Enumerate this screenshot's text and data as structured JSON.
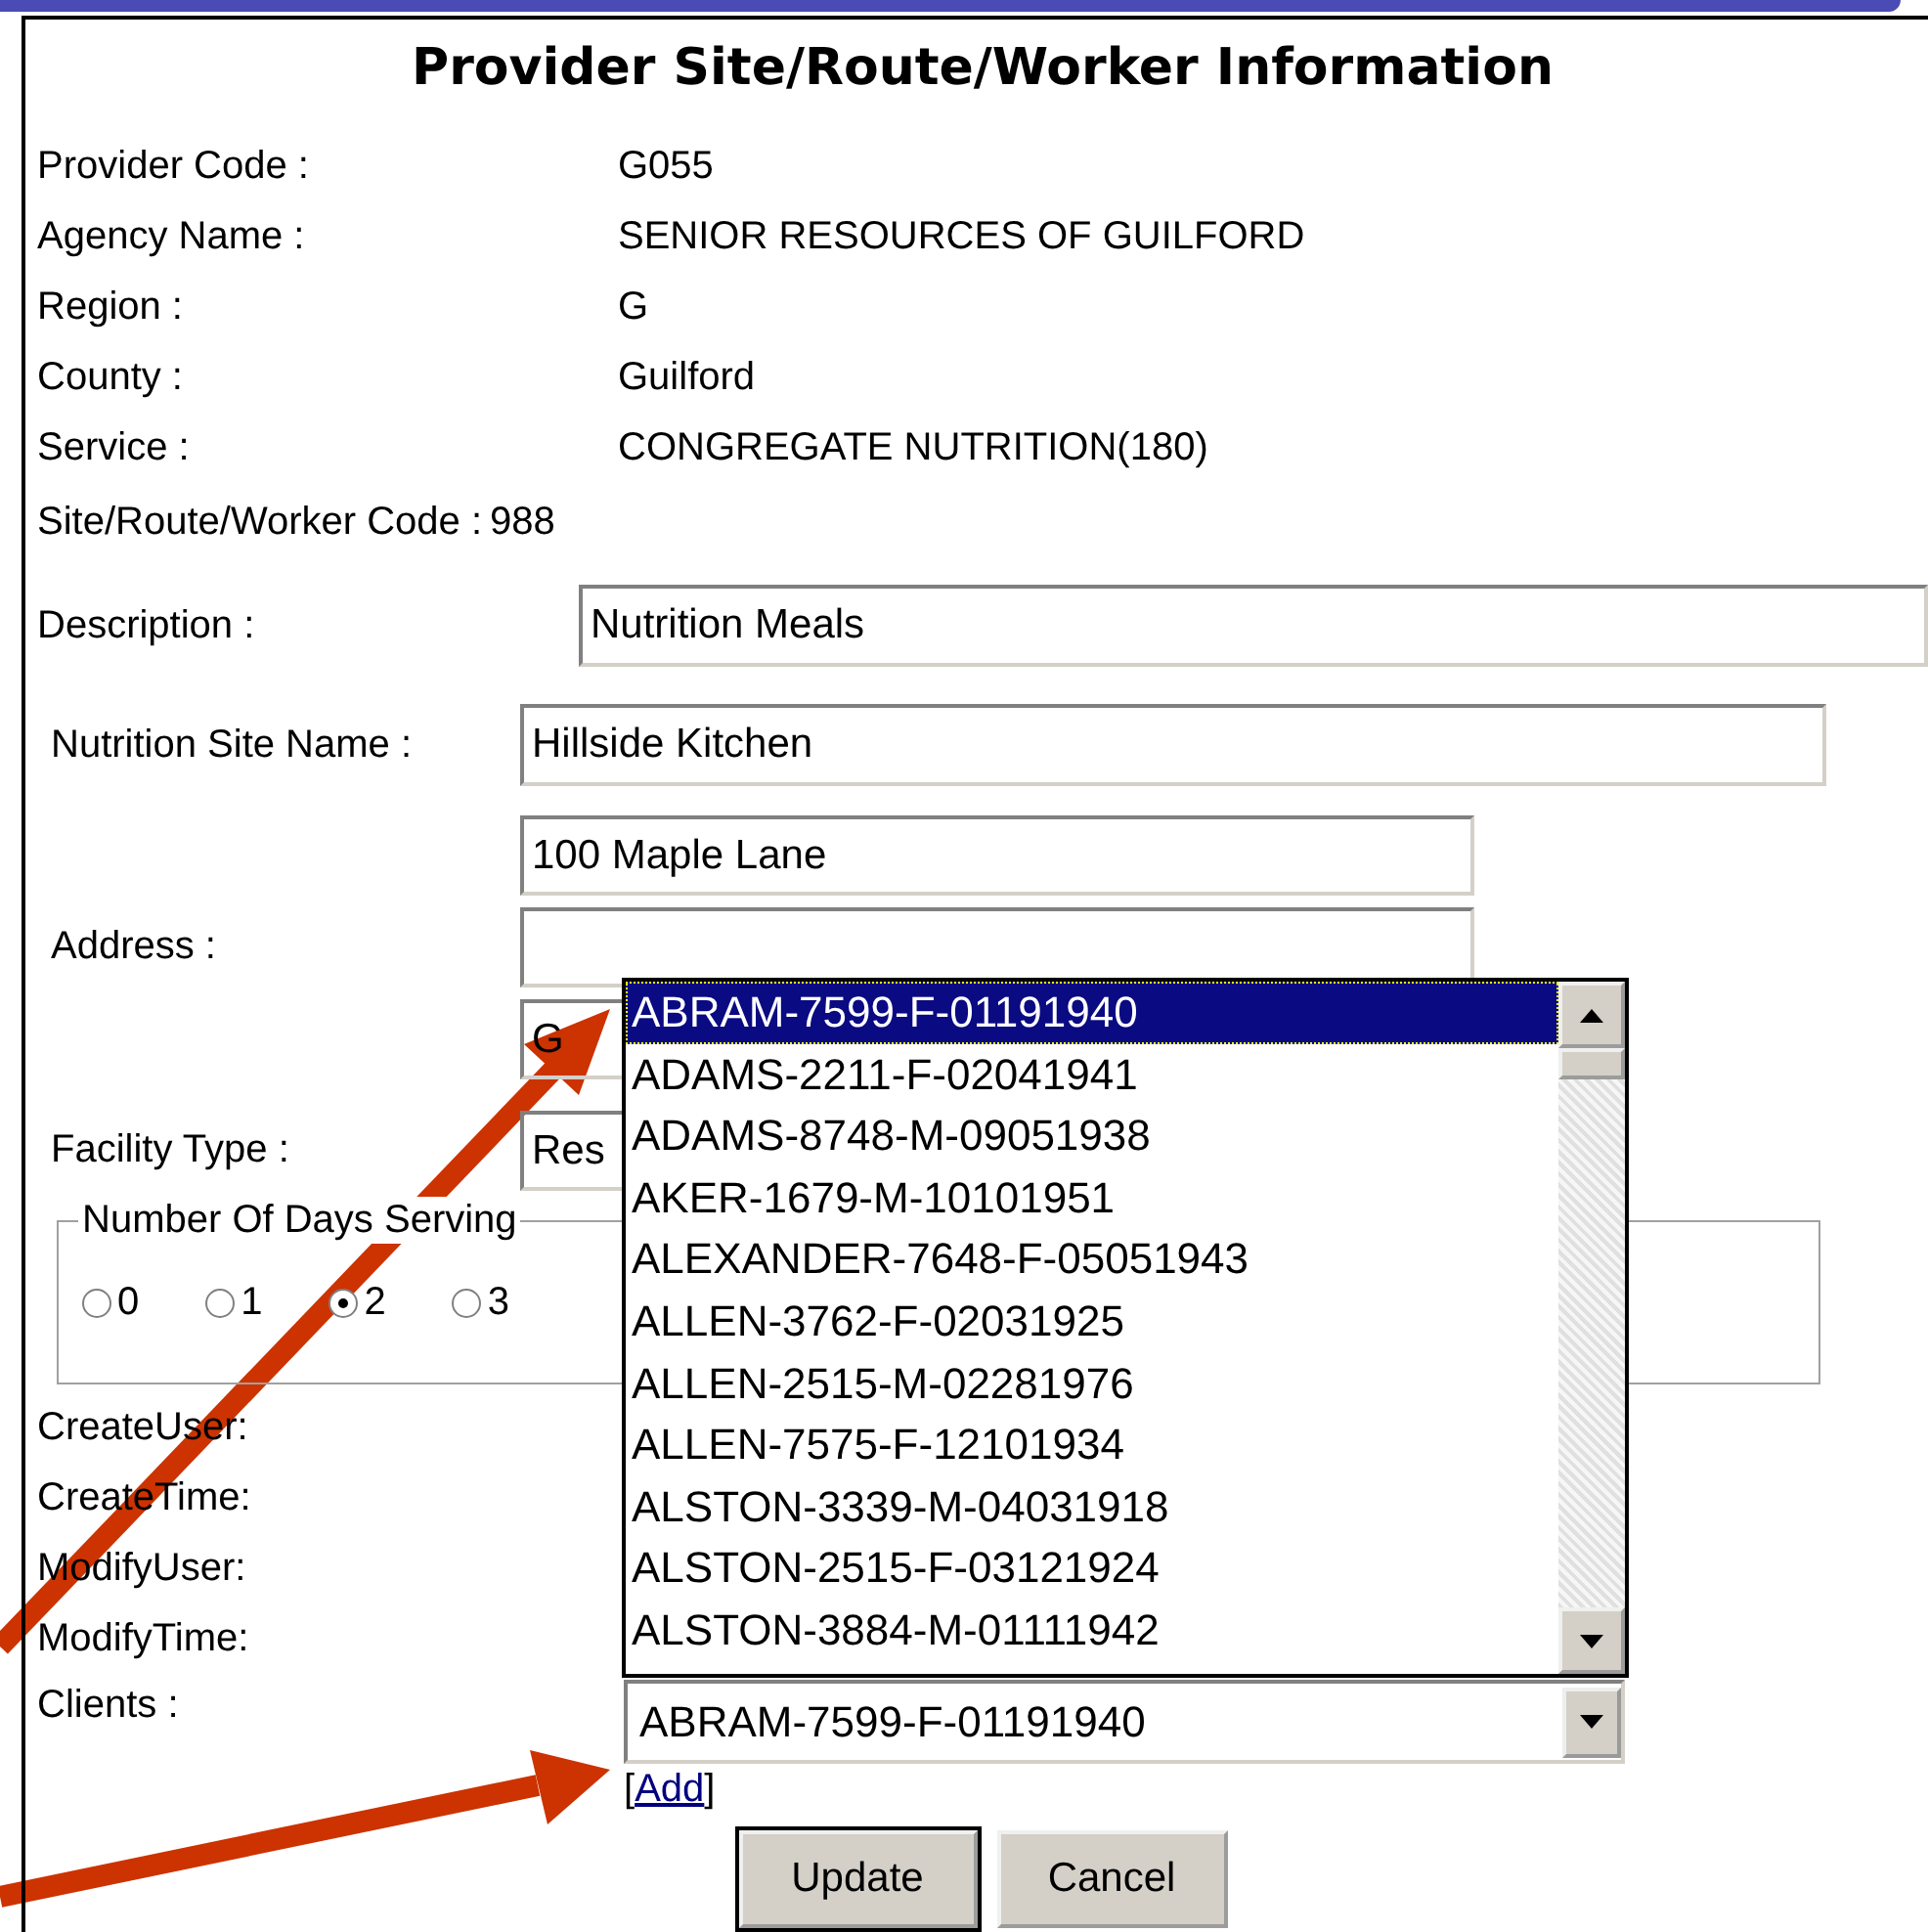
{
  "title": "Provider Site/Route/Worker Information",
  "info_rows": [
    {
      "label": "Provider Code :",
      "value": "G055"
    },
    {
      "label": "Agency Name :",
      "value": "SENIOR RESOURCES OF GUILFORD"
    },
    {
      "label": "Region :",
      "value": "G"
    },
    {
      "label": "County :",
      "value": "Guilford"
    },
    {
      "label": "Service :",
      "value": "CONGREGATE NUTRITION(180)"
    }
  ],
  "code_row": {
    "label": "Site/Route/Worker Code :",
    "value": "988"
  },
  "description": {
    "label": "Description :",
    "value": "Nutrition Meals"
  },
  "site_name": {
    "label": "Nutrition Site Name :",
    "value": "Hillside Kitchen"
  },
  "address": {
    "label": "Address :",
    "line_1": "100 Maple Lane",
    "city": "G"
  },
  "facility_type": {
    "label": "Facility Type :",
    "value": "Res"
  },
  "days_serving": {
    "legend": "Number Of Days Serving",
    "options": [
      {
        "label": "0",
        "selected": false
      },
      {
        "label": "1",
        "selected": false
      },
      {
        "label": "2",
        "selected": true
      },
      {
        "label": "3",
        "selected": false
      }
    ]
  },
  "audit_labels": [
    "CreateUser:",
    "CreateTime:",
    "ModifyUser:",
    "ModifyTime:"
  ],
  "clients": {
    "label": "Clients :",
    "value": "ABRAM-7599-F-01191940",
    "expanded": true,
    "options": [
      {
        "label": "ABRAM-7599-F-01191940",
        "selected": true
      },
      {
        "label": "ADAMS-2211-F-02041941",
        "selected": false
      },
      {
        "label": "ADAMS-8748-M-09051938",
        "selected": false
      },
      {
        "label": "AKER-1679-M-10101951",
        "selected": false
      },
      {
        "label": "ALEXANDER-7648-F-05051943",
        "selected": false
      },
      {
        "label": "ALLEN-3762-F-02031925",
        "selected": false
      },
      {
        "label": "ALLEN-2515-M-02281976",
        "selected": false
      },
      {
        "label": "ALLEN-7575-F-12101934",
        "selected": false
      },
      {
        "label": "ALSTON-3339-M-04031918",
        "selected": false
      },
      {
        "label": "ALSTON-2515-F-03121924",
        "selected": false
      },
      {
        "label": "ALSTON-3884-M-01111942",
        "selected": false
      }
    ]
  },
  "add_link": {
    "before": "[",
    "text": "Add",
    "after": "]"
  },
  "buttons": [
    "Update",
    "Cancel"
  ]
}
